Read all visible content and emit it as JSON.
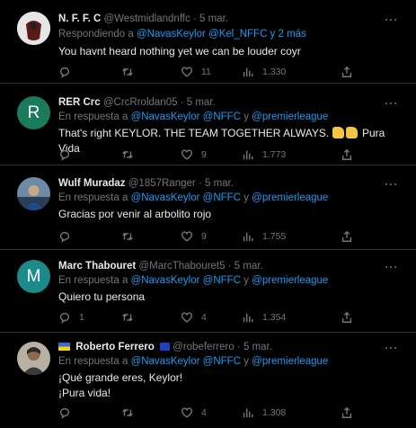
{
  "tweets": [
    {
      "name": "N. F. F. C",
      "handle": "@Westmidlandnffc",
      "date": "5 mar.",
      "reply_prefix": "Respondiendo a",
      "reply_mentions": "@NavasKeylor @Kel_NFFC y 2 más",
      "text": "You havnt heard nothing yet we can be louder coyr",
      "replies": "",
      "retweets": "",
      "likes": "11",
      "views": "1.330",
      "avatar_color": "#c8c8c8"
    },
    {
      "name": "RER Crc",
      "handle": "@CrcRroldan05",
      "date": "5 mar.",
      "reply_prefix": "En respuesta a",
      "reply_mention_1": "@NavasKeylor",
      "reply_mention_2": "@NFFC",
      "reply_and": "y",
      "reply_mention_3": "@premierleague",
      "text": "That's right KEYLOR. THE TEAM TOGETHER ALWAYS.",
      "text_suffix": "Pura Vida",
      "emoji": "thumbs-up",
      "replies": "",
      "retweets": "",
      "likes": "9",
      "views": "1.773",
      "avatar_letter": "R",
      "avatar_color": "#1a7a5c"
    },
    {
      "name": "Wulf Muradaz",
      "handle": "@1857Ranger",
      "date": "5 mar.",
      "reply_prefix": "En respuesta a",
      "reply_mention_1": "@NavasKeylor",
      "reply_mention_2": "@NFFC",
      "reply_and": "y",
      "reply_mention_3": "@premierleague",
      "text": "Gracias por venir al arbolito rojo",
      "replies": "",
      "retweets": "",
      "likes": "9",
      "views": "1.755",
      "avatar_color": "#4a6c8c"
    },
    {
      "name": "Marc Thabouret",
      "handle": "@MarcThabouret5",
      "date": "5 mar.",
      "reply_prefix": "En respuesta a",
      "reply_mention_1": "@NavasKeylor",
      "reply_mention_2": "@NFFC",
      "reply_and": "y",
      "reply_mention_3": "@premierleague",
      "text": "Quiero tu persona",
      "replies": "1",
      "retweets": "",
      "likes": "4",
      "views": "1.354",
      "avatar_letter": "M",
      "avatar_color": "#1b8a8a"
    },
    {
      "name": "Roberto Ferrero",
      "handle": "@robeferrero",
      "date": "5 mar.",
      "reply_prefix": "En respuesta a",
      "reply_mention_1": "@NavasKeylor",
      "reply_mention_2": "@NFFC",
      "reply_and": "y",
      "reply_mention_3": "@premierleague",
      "text_line1": "¡Qué grande eres, Keylor!",
      "text_line2": "¡Pura vida!",
      "replies": "",
      "retweets": "",
      "likes": "4",
      "views": "1.308",
      "avatar_color": "#8a7a5a"
    }
  ],
  "icons": {
    "reply": "reply-icon",
    "retweet": "retweet-icon",
    "like": "heart-icon",
    "views": "views-icon",
    "share": "share-icon",
    "more": "more-icon"
  },
  "colors": {
    "background": "#000000",
    "text": "#e7e9ea",
    "secondary": "#71767b",
    "link": "#1d9bf0",
    "divider": "#2f3336"
  }
}
